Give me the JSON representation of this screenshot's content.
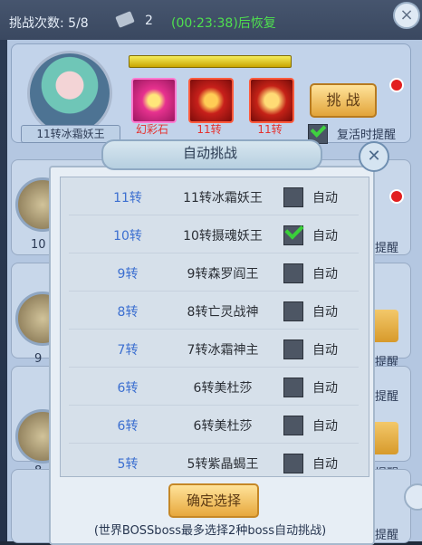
{
  "topbar": {
    "challenge_count_label": "挑战次数: 5/8",
    "ticket_count": "2",
    "timer_text": "(00:23:38)后恢复"
  },
  "top_card": {
    "boss_name": "11转冰霜妖王",
    "items": [
      {
        "icon": "pink-gem-icon",
        "label": "幻彩石"
      },
      {
        "icon": "red-equipment-icon",
        "label": "11转"
      },
      {
        "icon": "red-equipment-icon",
        "label": "11转"
      }
    ],
    "challenge_button": "挑 战",
    "revive_remind_label": "复活时提醒",
    "revive_remind_checked": true
  },
  "background_rows": {
    "labels": [
      "10",
      "9",
      "8",
      "提醒",
      "提醒",
      "提醒",
      "提醒",
      "提醒"
    ]
  },
  "popup": {
    "title": "自动挑战",
    "rows": [
      {
        "level": "11转",
        "boss": "11转冰霜妖王",
        "checked": false,
        "label": "自动"
      },
      {
        "level": "10转",
        "boss": "10转摄魂妖王",
        "checked": true,
        "label": "自动"
      },
      {
        "level": "9转",
        "boss": "9转森罗阎王",
        "checked": false,
        "label": "自动"
      },
      {
        "level": "8转",
        "boss": "8转亡灵战神",
        "checked": false,
        "label": "自动"
      },
      {
        "level": "7转",
        "boss": "7转冰霜神主",
        "checked": false,
        "label": "自动"
      },
      {
        "level": "6转",
        "boss": "6转美杜莎",
        "checked": false,
        "label": "自动"
      },
      {
        "level": "6转",
        "boss": "6转美杜莎",
        "checked": false,
        "label": "自动"
      },
      {
        "level": "5转",
        "boss": "5转紫晶蝎王",
        "checked": false,
        "label": "自动"
      }
    ],
    "confirm_button": "确定选择",
    "note": "(世界BOSSboss最多选择2种boss自动挑战)"
  }
}
